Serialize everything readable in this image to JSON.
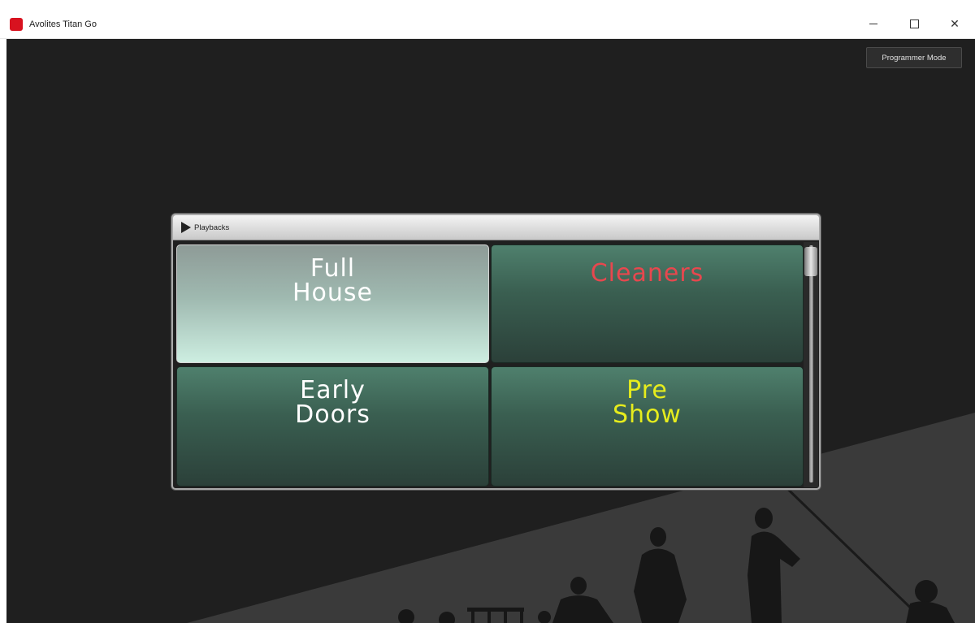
{
  "window": {
    "title": "Avolites Titan Go"
  },
  "toolbar": {
    "programmer_mode_label": "Programmer Mode"
  },
  "playbacks": {
    "title": "Playbacks",
    "tiles": [
      {
        "line1": "Full",
        "line2": "House",
        "color": "#ffffff",
        "state": "active"
      },
      {
        "line1": "Cleaners",
        "line2": "",
        "color": "#e8474e",
        "state": "inactive"
      },
      {
        "line1": "Early",
        "line2": "Doors",
        "color": "#ffffff",
        "state": "inactive"
      },
      {
        "line1": "Pre",
        "line2": "Show",
        "color": "#e6ec1d",
        "state": "inactive"
      }
    ]
  },
  "colors": {
    "background": "#1f1f1f",
    "tile_green": "#3f6a5a",
    "tile_active": "#cdeee1",
    "brand_red": "#d8121f"
  },
  "icons": {
    "app": "avolites-logo-icon",
    "panel_expand": "play-arrow-icon",
    "minimize": "minimize-icon",
    "maximize": "maximize-icon",
    "close": "close-icon"
  }
}
